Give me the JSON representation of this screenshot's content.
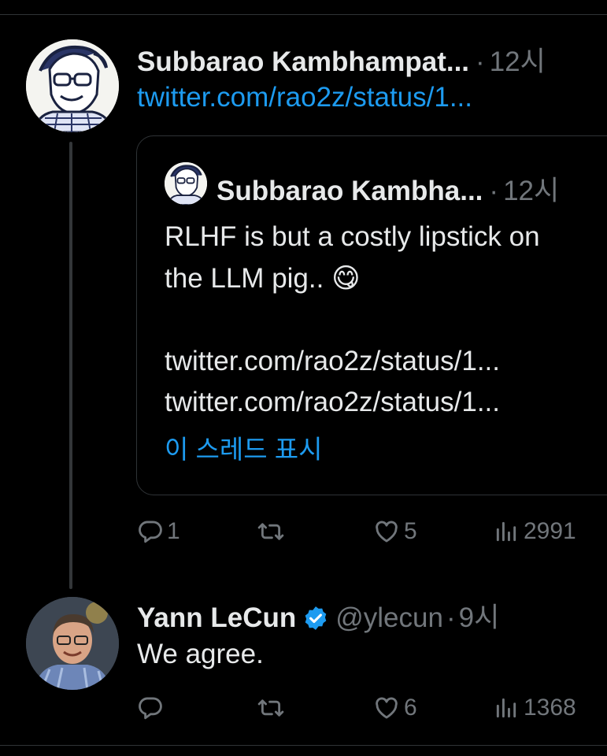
{
  "tweet1": {
    "author": "Subbarao Kambhampat...",
    "dot": "·",
    "time": "12시",
    "link": "twitter.com/rao2z/status/1...",
    "quote": {
      "author": "Subbarao Kambha...",
      "dot": "·",
      "time": "12시",
      "text_line1": "RLHF is but a costly lipstick on",
      "text_line2": "the LLM pig.. 😋",
      "link1": "twitter.com/rao2z/status/1...",
      "link2": "twitter.com/rao2z/status/1...",
      "show_thread": "이 스레드 표시"
    },
    "replies": "1",
    "retweets": "",
    "likes": "5",
    "views": "2991"
  },
  "tweet2": {
    "author": "Yann LeCun",
    "handle": "@ylecun",
    "dot": "·",
    "time": "9시",
    "text": "We agree.",
    "replies": "",
    "retweets": "",
    "likes": "6",
    "views": "1368"
  },
  "colors": {
    "background": "#000000",
    "text": "#e7e9ea",
    "muted": "#71767b",
    "link": "#1d9bf0",
    "border": "#2f3336",
    "verified": "#1d9bf0"
  },
  "icons": [
    "reply-icon",
    "retweet-icon",
    "like-icon",
    "views-icon",
    "verified-badge-icon"
  ]
}
